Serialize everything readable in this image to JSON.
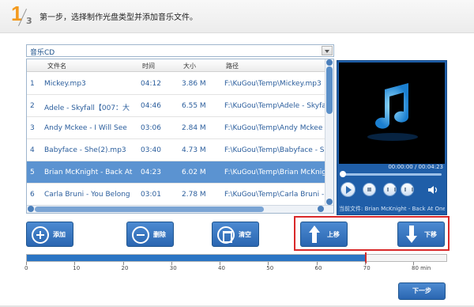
{
  "header": {
    "step_number": "1",
    "step_total": "3",
    "title": "第一步，选择制作光盘类型并添加音乐文件。"
  },
  "disc_type": {
    "selected": "音乐CD"
  },
  "table": {
    "columns": {
      "name": "文件名",
      "time": "时间",
      "size": "大小",
      "path": "路径"
    },
    "rows": [
      {
        "no": "1",
        "name": "Mickey.mp3",
        "time": "04:12",
        "size": "3.86 M",
        "path": "F:\\KuGou\\Temp\\Mickey.mp3",
        "selected": false
      },
      {
        "no": "2",
        "name": "Adele - Skyfall【007：大",
        "time": "04:46",
        "size": "6.55 M",
        "path": "F:\\KuGou\\Temp\\Adele - Skyfa",
        "selected": false
      },
      {
        "no": "3",
        "name": "Andy Mckee - I Will See",
        "time": "03:06",
        "size": "2.84 M",
        "path": "F:\\KuGou\\Temp\\Andy Mckee",
        "selected": false
      },
      {
        "no": "4",
        "name": "Babyface - She(2).mp3",
        "time": "03:40",
        "size": "4.73 M",
        "path": "F:\\KuGou\\Temp\\Babyface - S",
        "selected": false
      },
      {
        "no": "5",
        "name": "Brian McKnight - Back At",
        "time": "04:23",
        "size": "6.02 M",
        "path": "F:\\KuGou\\Temp\\Brian McKnigh",
        "selected": true
      },
      {
        "no": "6",
        "name": "Carla Bruni - You Belong",
        "time": "03:01",
        "size": "2.78 M",
        "path": "F:\\KuGou\\Temp\\Carla Bruni -",
        "selected": false
      }
    ]
  },
  "player": {
    "time": "00:00:00 / 00:04:23",
    "now_playing": "当前文件: Brian McKnight - Back At One.m",
    "accent": "#1f5ea8"
  },
  "actions": {
    "add": "添加",
    "delete": "删除",
    "clear": "清空",
    "move_up": "上移",
    "move_down": "下移"
  },
  "capacity": {
    "used_minutes": 70,
    "max_minutes": 80,
    "marker_minutes": 70,
    "tick_labels": [
      "0",
      "10",
      "20",
      "30",
      "40",
      "50",
      "60",
      "70",
      "80 min"
    ]
  },
  "footer": {
    "next": "下一步"
  },
  "colors": {
    "step_accent": "#f39a1e",
    "highlight_box": "#d9292a",
    "selected_row": "#5b93d1"
  }
}
